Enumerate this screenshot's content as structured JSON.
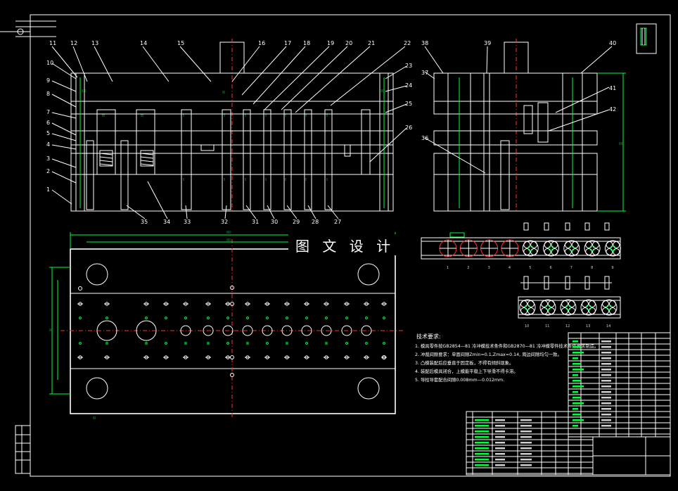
{
  "watermark": "图 文 设 计",
  "part_numbers_top": [
    "11",
    "12",
    "13",
    "14",
    "15",
    "16",
    "17",
    "18",
    "19",
    "20",
    "21",
    "22"
  ],
  "part_numbers_left": [
    "10",
    "9",
    "8",
    "7",
    "6",
    "5",
    "4",
    "3",
    "2",
    "1"
  ],
  "part_numbers_right": [
    "23",
    "24",
    "25",
    "26"
  ],
  "part_numbers_bottom": [
    "35",
    "34",
    "33",
    "32",
    "31",
    "30",
    "29",
    "28",
    "27"
  ],
  "side_numbers_top": [
    "38",
    "39",
    "40"
  ],
  "side_numbers_left": [
    "37",
    "36"
  ],
  "side_numbers_right": [
    "41",
    "42"
  ],
  "strip_labels_row1": [
    "1",
    "2",
    "3",
    "4",
    "5",
    "6",
    "7",
    "8",
    "9"
  ],
  "strip_labels_row2": [
    "10",
    "11",
    "12",
    "13",
    "14"
  ],
  "tech_requirements": {
    "heading": "技术要求:",
    "items": [
      "1. 模具零件按GB2854—81 冷冲模技术条件和GB2870—81 冷冲模零件技术条件要求制造。",
      "2. 冲裁间隙要求：单面间隙Zmin=0.1,Zmax=0.14, 周边间隙均匀一致。",
      "3. 凸模装配后应垂直于固定板，不得有倾斜现象。",
      "4. 装配后模具闭合，上模能平稳上下导滑不得卡滞。",
      "5. 导柱导套配合间隙0.008mm—0.012mm."
    ]
  },
  "colors": {
    "outline": "#ffffff",
    "dimension": "#00ff40",
    "hatch": "#22d6e6",
    "center": "#ff3030",
    "background": "#000000"
  }
}
